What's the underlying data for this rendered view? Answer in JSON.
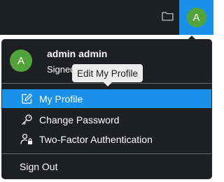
{
  "header": {
    "folder_icon": "folder-icon",
    "avatar_initial": "A",
    "accent_color": "#1a91e8"
  },
  "user": {
    "initial": "A",
    "name": "admin admin",
    "subtitle": "Signed in as admin"
  },
  "menu": {
    "items": [
      {
        "label": "My Profile",
        "icon": "edit-icon",
        "active": true
      },
      {
        "label": "Change Password",
        "icon": "key-icon",
        "active": false
      },
      {
        "label": "Two-Factor Authentication",
        "icon": "user-lock-icon",
        "active": false
      }
    ],
    "signout_label": "Sign Out"
  },
  "tooltip": {
    "text": "Edit My Profile"
  }
}
